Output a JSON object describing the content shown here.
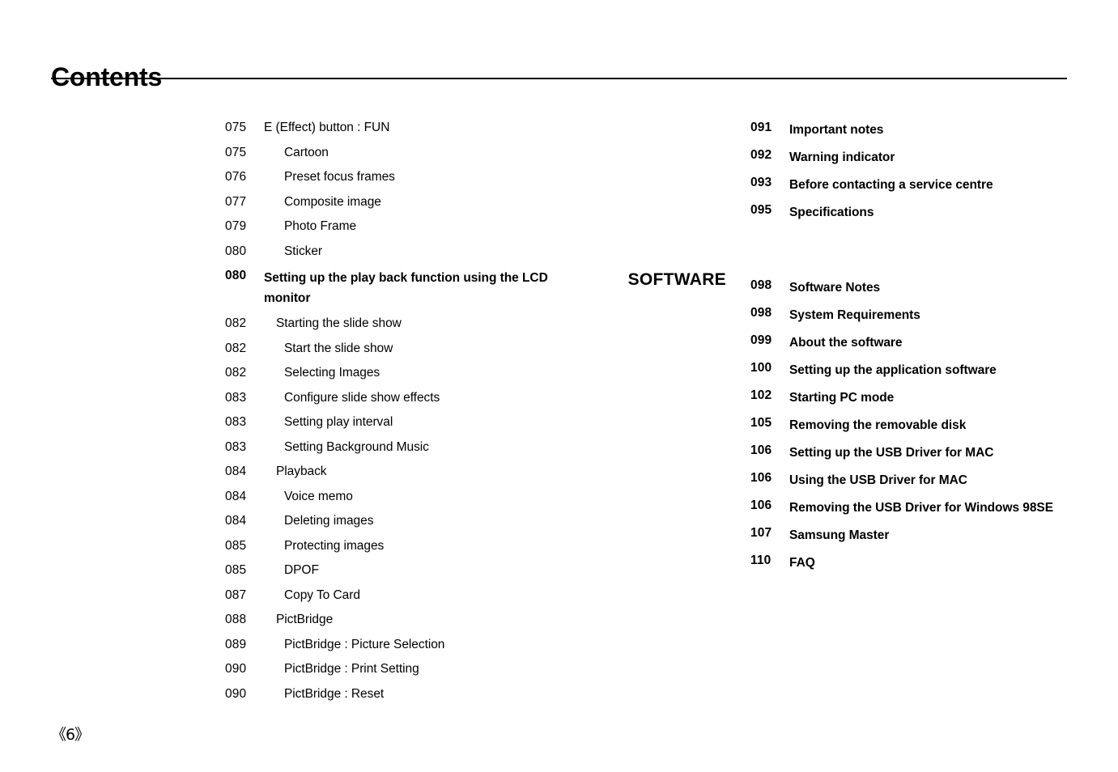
{
  "page": {
    "heading": "Contents",
    "folio": "《6》"
  },
  "sections": [
    {
      "label": "",
      "label_name": "section-label-none"
    },
    {
      "label": "SOFTWARE",
      "label_name": "section-label-software"
    }
  ],
  "left_column": [
    {
      "page": "075",
      "title": "E (Effect) button : FUN",
      "level": 1,
      "bold": false
    },
    {
      "page": "075",
      "title": "Cartoon",
      "level": 3,
      "bold": false
    },
    {
      "page": "076",
      "title": "Preset focus frames",
      "level": 3,
      "bold": false
    },
    {
      "page": "077",
      "title": "Composite image",
      "level": 3,
      "bold": false
    },
    {
      "page": "079",
      "title": "Photo Frame",
      "level": 3,
      "bold": false
    },
    {
      "page": "080",
      "title": "Sticker",
      "level": 3,
      "bold": false
    },
    {
      "page": "080",
      "title": "Setting up the play back function using the LCD monitor",
      "level": 1,
      "bold": true
    },
    {
      "page": "082",
      "title": "Starting the slide show",
      "level": 2,
      "bold": false
    },
    {
      "page": "082",
      "title": "Start the slide show",
      "level": 3,
      "bold": false
    },
    {
      "page": "082",
      "title": "Selecting Images",
      "level": 3,
      "bold": false
    },
    {
      "page": "083",
      "title": "Configure slide show effects",
      "level": 3,
      "bold": false
    },
    {
      "page": "083",
      "title": "Setting play interval",
      "level": 3,
      "bold": false
    },
    {
      "page": "083",
      "title": "Setting Background Music",
      "level": 3,
      "bold": false
    },
    {
      "page": "084",
      "title": "Playback",
      "level": 2,
      "bold": false
    },
    {
      "page": "084",
      "title": "Voice memo",
      "level": 3,
      "bold": false
    },
    {
      "page": "084",
      "title": "Deleting images",
      "level": 3,
      "bold": false
    },
    {
      "page": "085",
      "title": "Protecting images",
      "level": 3,
      "bold": false
    },
    {
      "page": "085",
      "title": "DPOF",
      "level": 3,
      "bold": false
    },
    {
      "page": "087",
      "title": "Copy To Card",
      "level": 3,
      "bold": false
    },
    {
      "page": "088",
      "title": "PictBridge",
      "level": 2,
      "bold": false
    },
    {
      "page": "089",
      "title": "PictBridge : Picture Selection",
      "level": 3,
      "bold": false
    },
    {
      "page": "090",
      "title": "PictBridge : Print Setting",
      "level": 3,
      "bold": false
    },
    {
      "page": "090",
      "title": "PictBridge : Reset",
      "level": 3,
      "bold": false
    }
  ],
  "right_column": [
    {
      "page": "091",
      "title": "Important notes",
      "level": 1,
      "bold": true,
      "gap_before": false
    },
    {
      "page": "092",
      "title": "Warning indicator",
      "level": 1,
      "bold": true,
      "gap_before": false
    },
    {
      "page": "093",
      "title": "Before contacting a service centre",
      "level": 1,
      "bold": true,
      "gap_before": false
    },
    {
      "page": "095",
      "title": "Specifications",
      "level": 1,
      "bold": true,
      "gap_before": false
    },
    {
      "page": "098",
      "title": "Software Notes",
      "level": 1,
      "bold": true,
      "gap_before": true
    },
    {
      "page": "098",
      "title": "System Requirements",
      "level": 1,
      "bold": true,
      "gap_before": false
    },
    {
      "page": "099",
      "title": "About the software",
      "level": 1,
      "bold": true,
      "gap_before": false
    },
    {
      "page": "100",
      "title": "Setting up the application software",
      "level": 1,
      "bold": true,
      "gap_before": false
    },
    {
      "page": "102",
      "title": "Starting PC mode",
      "level": 1,
      "bold": true,
      "gap_before": false
    },
    {
      "page": "105",
      "title": "Removing the removable disk",
      "level": 1,
      "bold": true,
      "gap_before": false
    },
    {
      "page": "106",
      "title": "Setting up the USB Driver for MAC",
      "level": 1,
      "bold": true,
      "gap_before": false
    },
    {
      "page": "106",
      "title": "Using the USB Driver for MAC",
      "level": 1,
      "bold": true,
      "gap_before": false
    },
    {
      "page": "106",
      "title": "Removing the USB Driver for Windows 98SE",
      "level": 1,
      "bold": true,
      "gap_before": false
    },
    {
      "page": "107",
      "title": "Samsung Master",
      "level": 1,
      "bold": true,
      "gap_before": false
    },
    {
      "page": "110",
      "title": "FAQ",
      "level": 1,
      "bold": true,
      "gap_before": false
    }
  ]
}
